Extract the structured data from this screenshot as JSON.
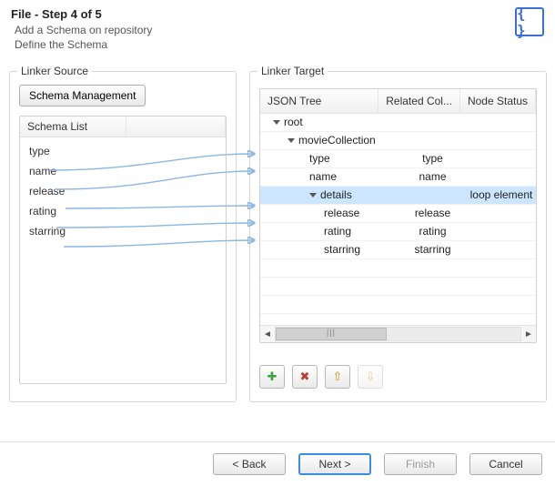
{
  "header": {
    "title": "File - Step 4 of 5",
    "subtitle_line1": "Add a Schema on repository",
    "subtitle_line2": "Define the Schema",
    "badge_text": "{ }"
  },
  "linker_source": {
    "label": "Linker Source",
    "schema_mgmt_button": "Schema Management",
    "list_header": "Schema List",
    "items": [
      "type",
      "name",
      "release",
      "rating",
      "starring"
    ]
  },
  "linker_target": {
    "label": "Linker Target",
    "columns": {
      "c1": "JSON Tree",
      "c2": "Related Col...",
      "c3": "Node Status"
    },
    "rows": [
      {
        "indent": 1,
        "expander": true,
        "label": "root",
        "related": "",
        "status": "",
        "selected": false
      },
      {
        "indent": 2,
        "expander": true,
        "label": "movieCollection",
        "related": "",
        "status": "",
        "selected": false
      },
      {
        "indent": 3,
        "expander": false,
        "label": "type",
        "related": "type",
        "status": "",
        "selected": false
      },
      {
        "indent": 3,
        "expander": false,
        "label": "name",
        "related": "name",
        "status": "",
        "selected": false
      },
      {
        "indent": 3,
        "expander": true,
        "label": "details",
        "related": "",
        "status": "loop element",
        "selected": true
      },
      {
        "indent": 4,
        "expander": false,
        "label": "release",
        "related": "release",
        "status": "",
        "selected": false
      },
      {
        "indent": 4,
        "expander": false,
        "label": "rating",
        "related": "rating",
        "status": "",
        "selected": false
      },
      {
        "indent": 4,
        "expander": false,
        "label": "starring",
        "related": "starring",
        "status": "",
        "selected": false
      }
    ],
    "tools": {
      "add": {
        "glyph": "✚",
        "color": "#3aa23a",
        "enabled": true
      },
      "remove": {
        "glyph": "✖",
        "color": "#c0392b",
        "enabled": true
      },
      "up": {
        "glyph": "⇧",
        "color": "#d48b00",
        "enabled": true
      },
      "down": {
        "glyph": "⇩",
        "color": "#d48b00",
        "enabled": false
      }
    }
  },
  "footer": {
    "back": "< Back",
    "next": "Next >",
    "finish": "Finish",
    "cancel": "Cancel"
  }
}
